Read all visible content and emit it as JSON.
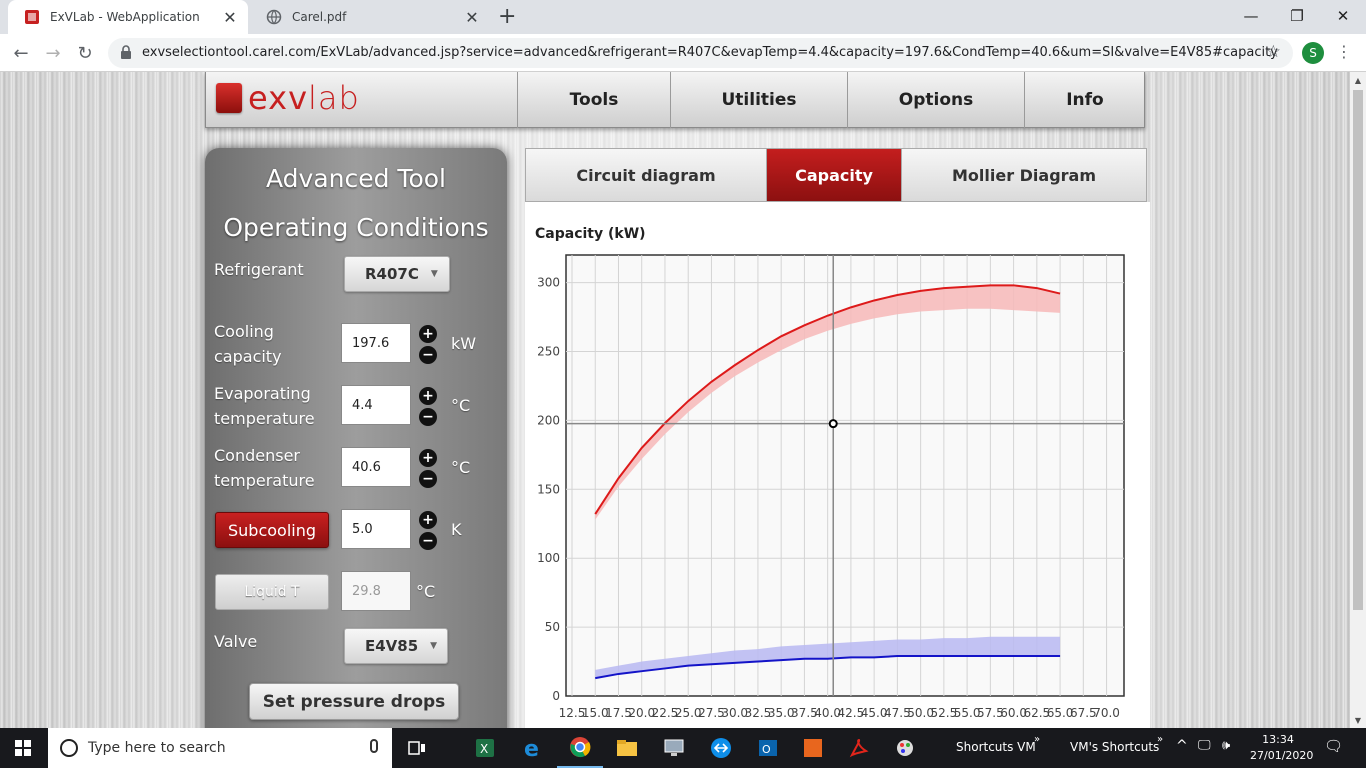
{
  "browser": {
    "tabs": [
      {
        "title": "ExVLab - WebApplication"
      },
      {
        "title": "Carel.pdf"
      }
    ],
    "url": "exvselectiontool.carel.com/ExVLab/advanced.jsp?service=advanced&refrigerant=R407C&evapTemp=4.4&capacity=197.6&CondTemp=40.6&um=SI&valve=E4V85#capacity",
    "profile_initial": "S",
    "icons": [
      "back-icon",
      "forward-icon",
      "reload-icon",
      "lock-icon",
      "star-icon",
      "menu-icon"
    ]
  },
  "header": {
    "logo_ex": "exv",
    "logo_lab": "lab",
    "nav": [
      "Tools",
      "Utilities",
      "Options",
      "Info"
    ]
  },
  "panel": {
    "title": "Advanced Tool",
    "subtitle": "Operating Conditions",
    "refrigerant_label": "Refrigerant",
    "refrigerant_value": "R407C",
    "capacity_label_1": "Cooling",
    "capacity_label_2": "capacity",
    "capacity_value": "197.6",
    "capacity_unit": "kW",
    "evap_label_1": "Evaporating",
    "evap_label_2": "temperature",
    "evap_value": "4.4",
    "evap_unit": "°C",
    "cond_label_1": "Condenser",
    "cond_label_2": "temperature",
    "cond_value": "40.6",
    "cond_unit": "°C",
    "subcooling_label": "Subcooling",
    "subcooling_value": "5.0",
    "subcooling_unit": "K",
    "liquid_label": "Liquid T",
    "liquid_value": "29.8",
    "liquid_unit": "°C",
    "valve_label": "Valve",
    "valve_value": "E4V85",
    "pressure_button": "Set pressure drops",
    "plus": "+",
    "minus": "−"
  },
  "tabs": [
    "Circuit diagram",
    "Capacity",
    "Mollier Diagram"
  ],
  "active_tab": "Capacity",
  "chart_data": {
    "type": "line",
    "title": "",
    "ylabel": "Capacity (kW)",
    "xlabel": "",
    "xlim": [
      12.5,
      70.0
    ],
    "ylim": [
      0,
      320
    ],
    "yticks": [
      0,
      50,
      100,
      150,
      200,
      250,
      300
    ],
    "xtick_labels": [
      "12.5",
      "15.0",
      "17.5",
      "20.0",
      "22.5",
      "25.0",
      "27.5",
      "30.0",
      "32.5",
      "35.0",
      "37.5",
      "40.0",
      "42.5",
      "45.0",
      "47.5",
      "50.0",
      "52.5",
      "55.0",
      "57.5",
      "60.0",
      "62.5",
      "65.0",
      "67.5",
      "70.0"
    ],
    "grid": true,
    "series": [
      {
        "color": "#dd1a1a",
        "band_color": "#f7b8b8",
        "x": [
          15.0,
          17.5,
          20.0,
          22.5,
          25.0,
          27.5,
          30.0,
          32.5,
          35.0,
          37.5,
          40.0,
          42.5,
          45.0,
          47.5,
          50.0,
          52.5,
          55.0,
          57.5,
          60.0,
          62.5,
          65.0
        ],
        "y": [
          132,
          158,
          180,
          198,
          214,
          228,
          240,
          251,
          261,
          269,
          276,
          282,
          287,
          291,
          294,
          296,
          297,
          298,
          298,
          296,
          292
        ],
        "lower": [
          128,
          152,
          172,
          190,
          206,
          220,
          232,
          242,
          251,
          259,
          265,
          270,
          274,
          277,
          279,
          280,
          281,
          281,
          280,
          279,
          278
        ]
      },
      {
        "color": "#1414c8",
        "band_color": "#b8b8f2",
        "x": [
          15.0,
          17.5,
          20.0,
          22.5,
          25.0,
          27.5,
          30.0,
          32.5,
          35.0,
          37.5,
          40.0,
          42.5,
          45.0,
          47.5,
          50.0,
          52.5,
          55.0,
          57.5,
          60.0,
          62.5,
          65.0
        ],
        "y": [
          13,
          16,
          18,
          20,
          22,
          23,
          24,
          25,
          26,
          27,
          27,
          28,
          28,
          29,
          29,
          29,
          29,
          29,
          29,
          29,
          29
        ],
        "upper": [
          19,
          22,
          25,
          27,
          29,
          31,
          33,
          34,
          36,
          37,
          38,
          39,
          40,
          41,
          41,
          42,
          42,
          43,
          43,
          43,
          43
        ]
      }
    ],
    "crosshair": {
      "x": 40.6,
      "y": 197.6
    }
  },
  "taskbar": {
    "search_placeholder": "Type here to search",
    "shortcuts_vm": "Shortcuts VM",
    "vms_shortcuts": "VM's Shortcuts",
    "time": "13:34",
    "date": "27/01/2020"
  }
}
